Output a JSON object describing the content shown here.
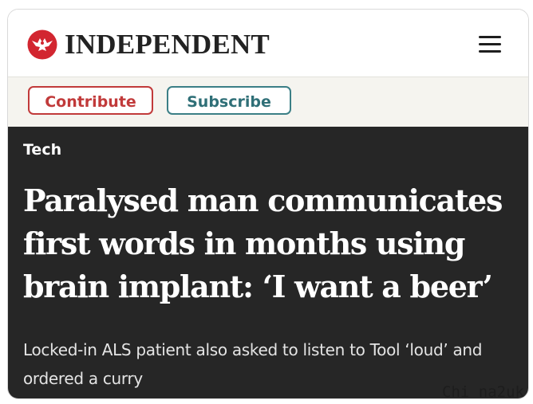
{
  "masthead": {
    "logo_text": "INDEPENDENT",
    "logo_icon": "eagle-logo-icon",
    "menu_icon": "hamburger-menu-icon"
  },
  "actions": {
    "contribute_label": "Contribute",
    "subscribe_label": "Subscribe"
  },
  "article": {
    "category": "Tech",
    "headline": "Paralysed man communicates first words in months using brain implant: ‘I want a beer’",
    "standfirst": "Locked-in ALS patient also asked to listen to Tool ‘loud’ and ordered a curry"
  },
  "watermark": "Chi na2uk",
  "colors": {
    "brand_red": "#d22630",
    "contribute_red": "#c13a3a",
    "subscribe_teal": "#3b7f86",
    "article_bg": "#262626",
    "actions_bg": "#f5f4ef"
  }
}
